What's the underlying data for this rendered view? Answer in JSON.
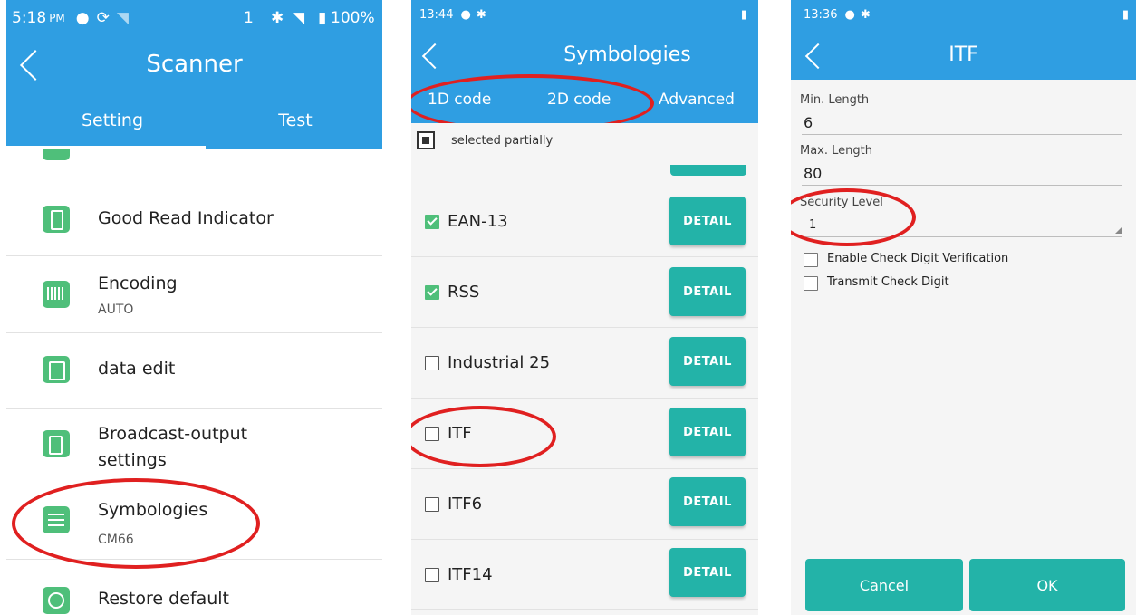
{
  "panel1": {
    "status": {
      "time": "5:18",
      "ampm": "PM",
      "sim": "1",
      "battery": "100%"
    },
    "title": "Scanner",
    "tabs": [
      {
        "label": "Setting"
      },
      {
        "label": "Test"
      }
    ],
    "items": [
      {
        "label": "Good Read Indicator",
        "sub": "",
        "icon": "phone-sound-icon"
      },
      {
        "label": "Encoding",
        "sub": "AUTO",
        "icon": "barcode-icon"
      },
      {
        "label": "data edit",
        "sub": "",
        "icon": "edit-icon"
      },
      {
        "label": "Broadcast-output",
        "label2": "settings",
        "sub": "",
        "icon": "export-icon"
      },
      {
        "label": "Symbologies",
        "sub": "CM66",
        "icon": "sliders-icon"
      },
      {
        "label": "Restore default",
        "sub": "",
        "icon": "clock-icon"
      }
    ]
  },
  "panel2": {
    "status": {
      "time": "13:44"
    },
    "title": "Symbologies",
    "tabs": [
      {
        "label": "1D code"
      },
      {
        "label": "2D code"
      },
      {
        "label": "Advanced"
      }
    ],
    "selected_partially": "selected partially",
    "rows": [
      {
        "label": "EAN-13",
        "checked": true,
        "button": "DETAIL"
      },
      {
        "label": "RSS",
        "checked": true,
        "button": "DETAIL"
      },
      {
        "label": "Industrial 25",
        "checked": false,
        "button": "DETAIL"
      },
      {
        "label": "ITF",
        "checked": false,
        "button": "DETAIL"
      },
      {
        "label": "ITF6",
        "checked": false,
        "button": "DETAIL"
      },
      {
        "label": "ITF14",
        "checked": false,
        "button": "DETAIL"
      }
    ]
  },
  "panel3": {
    "status": {
      "time": "13:36"
    },
    "title": "ITF",
    "min_length_label": "Min. Length",
    "min_length_value": "6",
    "max_length_label": "Max. Length",
    "max_length_value": "80",
    "security_level_label": "Security Level",
    "security_level_value": "1",
    "check_digit_verification": "Enable Check Digit Verification",
    "transmit_check_digit": "Transmit Check Digit",
    "cancel": "Cancel",
    "ok": "OK"
  },
  "colors": {
    "appbar": "#2f9ee2",
    "accent": "#23b3a8",
    "highlight": "#e02020",
    "icon": "#4fbf7a"
  }
}
